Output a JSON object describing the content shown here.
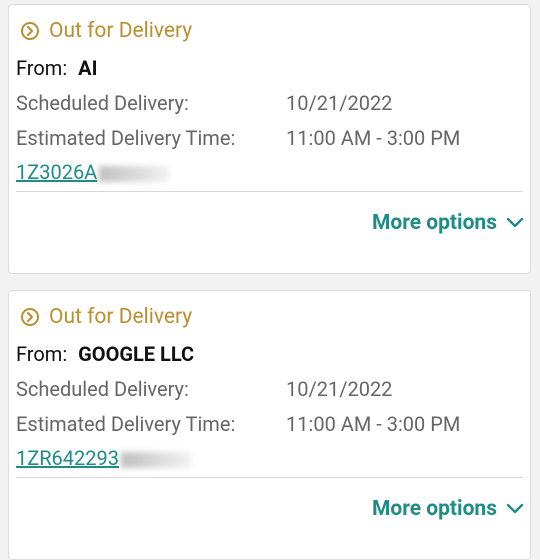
{
  "cards": [
    {
      "status": "Out for Delivery",
      "from_label": "From:",
      "from_value": "AI",
      "scheduled_label": "Scheduled Delivery:",
      "scheduled_value": "10/21/2022",
      "estimated_label": "Estimated Delivery Time:",
      "estimated_value": "11:00 AM - 3:00 PM",
      "tracking": "1Z3026A",
      "more_options": "More options"
    },
    {
      "status": "Out for Delivery",
      "from_label": "From:",
      "from_value": "GOOGLE LLC",
      "scheduled_label": "Scheduled Delivery:",
      "scheduled_value": "10/21/2022",
      "estimated_label": "Estimated Delivery Time:",
      "estimated_value": "11:00 AM - 3:00 PM",
      "tracking": "1ZR642293",
      "more_options": "More options"
    }
  ],
  "colors": {
    "status": "#b98f2f",
    "link": "#1f8c86",
    "label": "#666666",
    "background": "#f2f2f2"
  }
}
